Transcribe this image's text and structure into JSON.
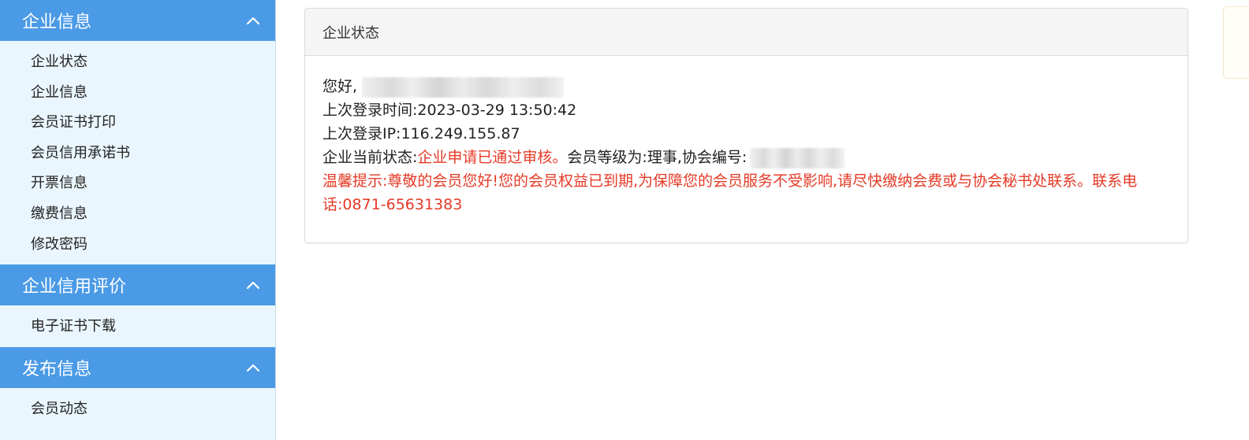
{
  "sidebar": {
    "sections": [
      {
        "title": "企业信息",
        "items": [
          "企业状态",
          "企业信息",
          "会员证书打印",
          "会员信用承诺书",
          "开票信息",
          "缴费信息",
          "修改密码"
        ]
      },
      {
        "title": "企业信用评价",
        "items": [
          "电子证书下载"
        ]
      },
      {
        "title": "发布信息",
        "items": [
          "会员动态"
        ]
      }
    ]
  },
  "panel": {
    "title": "企业状态",
    "greeting_label": "您好,",
    "last_login_time_label": "上次登录时间:",
    "last_login_time": "2023-03-29 13:50:42",
    "last_login_ip_label": "上次登录IP:",
    "last_login_ip": "116.249.155.87",
    "status_label": "企业当前状态:",
    "status_value": "企业申请已通过审核。",
    "member_level_text": "会员等级为:理事,协会编号:",
    "notice": "温馨提示:尊敬的会员您好!您的会员权益已到期,为保障您的会员服务不受影响,请尽快缴纳会费或与协会秘书处联系。联系电话:0871-65631383"
  },
  "colors": {
    "header_blue": "#4a9ae6",
    "sidebar_bg": "#eaf6fd",
    "alert_red": "#e53a26"
  }
}
